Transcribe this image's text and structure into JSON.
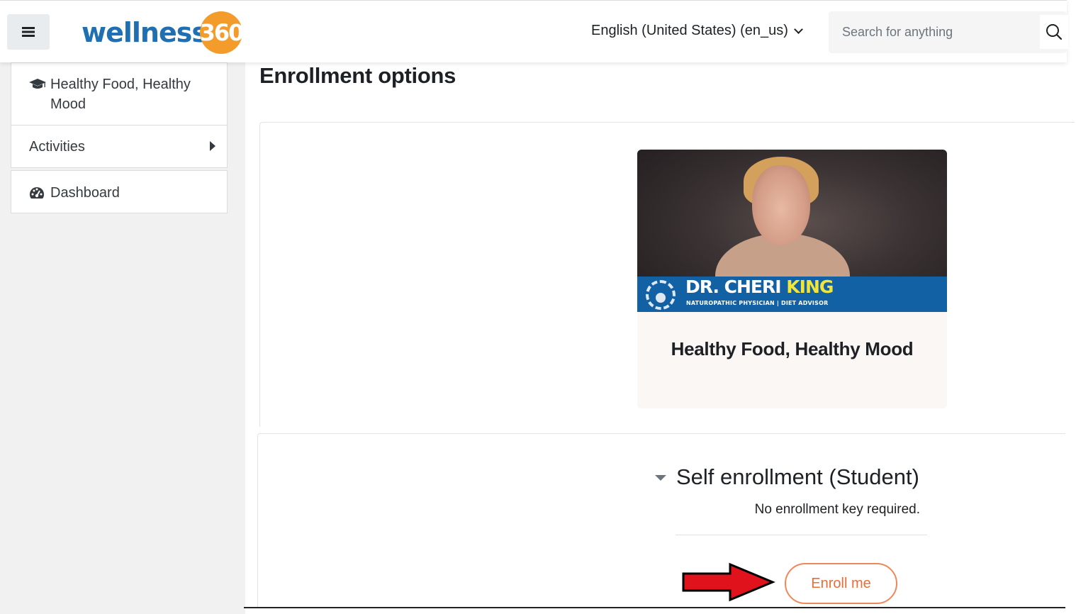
{
  "header": {
    "menu_icon": "hamburger-icon",
    "logo": {
      "text": "wellness",
      "number": "360",
      "brand_blue": "#1f6fb2",
      "brand_orange": "#f39c2c"
    },
    "language": "English (United States) (en_us)",
    "search": {
      "placeholder": "Search for anything",
      "icon": "search-icon"
    }
  },
  "drawer": {
    "course": {
      "icon": "graduation-cap-icon",
      "label": "Healthy Food, Healthy Mood"
    },
    "activities": {
      "label": "Activities",
      "icon": "caret-right-icon"
    },
    "dashboard": {
      "icon": "dashboard-gauge-icon",
      "label": "Dashboard"
    }
  },
  "main": {
    "title": "Enrollment options",
    "course_card": {
      "image_banner": {
        "name_part1": "DR. CHERI ",
        "name_part2": "KING",
        "subtitle": "NATUROPATHIC PHYSICIAN | DIET ADVISOR",
        "banner_color": "#1261a5",
        "highlight_color": "#f2e53a"
      },
      "title": "Healthy Food, Healthy Mood"
    },
    "self_enrollment": {
      "heading": "Self enrollment (Student)",
      "note": "No enrollment key required.",
      "button_label": "Enroll me",
      "button_color": "#e86d38",
      "pointer_arrow_color": "#e0131c"
    }
  }
}
